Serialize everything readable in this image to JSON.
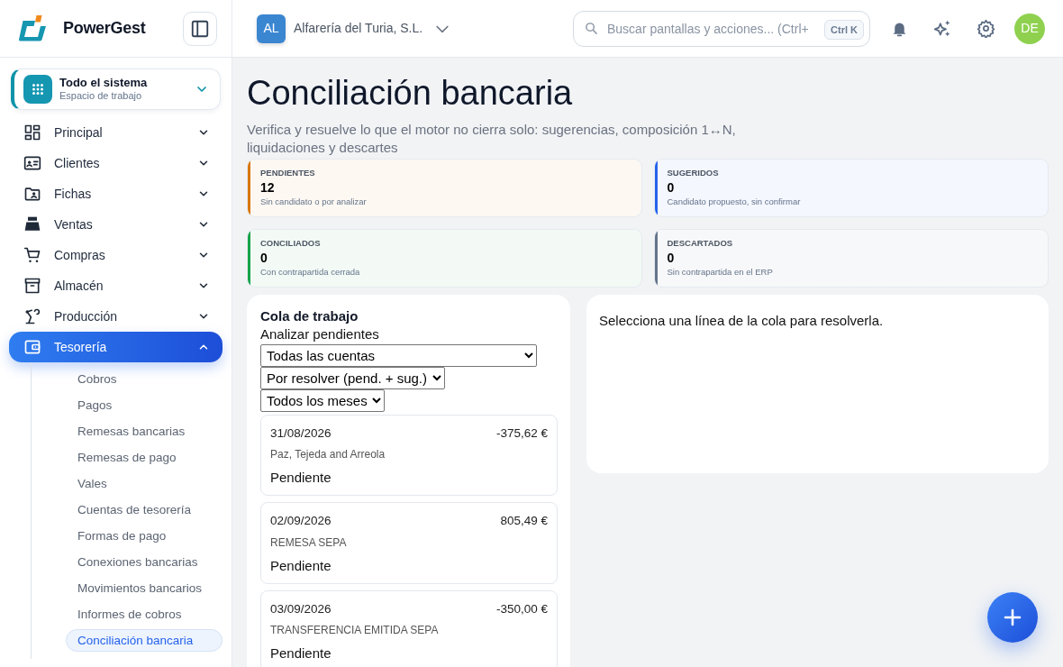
{
  "brand": {
    "name": "PowerGest"
  },
  "header": {
    "company": {
      "initials": "AL",
      "name": "Alfarería del Turia, S.L."
    },
    "search": {
      "placeholder": "Buscar pantallas y acciones... (Ctrl+",
      "shortcut": "Ctrl K"
    },
    "user": {
      "initials": "DE"
    }
  },
  "workspace": {
    "title": "Todo el sistema",
    "subtitle": "Espacio de trabajo"
  },
  "sidebar": {
    "items": [
      {
        "label": "Principal",
        "expanded": false,
        "selected": false
      },
      {
        "label": "Clientes",
        "expanded": false,
        "selected": false
      },
      {
        "label": "Fichas",
        "expanded": false,
        "selected": false
      },
      {
        "label": "Ventas",
        "expanded": false,
        "selected": false
      },
      {
        "label": "Compras",
        "expanded": false,
        "selected": false
      },
      {
        "label": "Almacén",
        "expanded": false,
        "selected": false
      },
      {
        "label": "Producción",
        "expanded": false,
        "selected": false
      },
      {
        "label": "Tesorería",
        "expanded": true,
        "selected": true,
        "children": [
          {
            "label": "Cobros",
            "selected": false
          },
          {
            "label": "Pagos",
            "selected": false
          },
          {
            "label": "Remesas bancarias",
            "selected": false
          },
          {
            "label": "Remesas de pago",
            "selected": false
          },
          {
            "label": "Vales",
            "selected": false
          },
          {
            "label": "Cuentas de tesorería",
            "selected": false
          },
          {
            "label": "Formas de pago",
            "selected": false
          },
          {
            "label": "Conexiones bancarias",
            "selected": false
          },
          {
            "label": "Movimientos bancarios",
            "selected": false
          },
          {
            "label": "Informes de cobros",
            "selected": false
          },
          {
            "label": "Conciliación bancaria",
            "selected": true
          }
        ]
      }
    ]
  },
  "page": {
    "title": "Conciliación bancaria",
    "subtitle": "Verifica y resuelve lo que el motor no cierra solo: sugerencias, composición 1↔N, liquidaciones y descartes"
  },
  "stats": [
    {
      "label": "PENDIENTES",
      "value": "12",
      "note": "Sin candidato o por analizar",
      "color": "#d97706"
    },
    {
      "label": "SUGERIDOS",
      "value": "0",
      "note": "Candidato propuesto, sin confirmar",
      "color": "#2563eb"
    },
    {
      "label": "CONCILIADOS",
      "value": "0",
      "note": "Con contrapartida cerrada",
      "color": "#16a34a"
    },
    {
      "label": "DESCARTADOS",
      "value": "0",
      "note": "Sin contrapartida en el ERP",
      "color": "#64748b"
    }
  ],
  "queue": {
    "title": "Cola de trabajo",
    "action": "Analizar pendientes",
    "filters": [
      "Todas las cuentas",
      "Por resolver (pend. + sug.)",
      "Todos los meses"
    ],
    "items": [
      {
        "date": "31/08/2026",
        "amount": "-375,62 €",
        "payee": "Paz, Tejeda and Arreola",
        "status": "Pendiente"
      },
      {
        "date": "02/09/2026",
        "amount": "805,49 €",
        "payee": "REMESA SEPA",
        "status": "Pendiente"
      },
      {
        "date": "03/09/2026",
        "amount": "-350,00 €",
        "payee": "TRANSFERENCIA EMITIDA SEPA",
        "status": "Pendiente"
      }
    ]
  },
  "detail": {
    "message": "Selecciona una línea de la cola para resolverla."
  }
}
